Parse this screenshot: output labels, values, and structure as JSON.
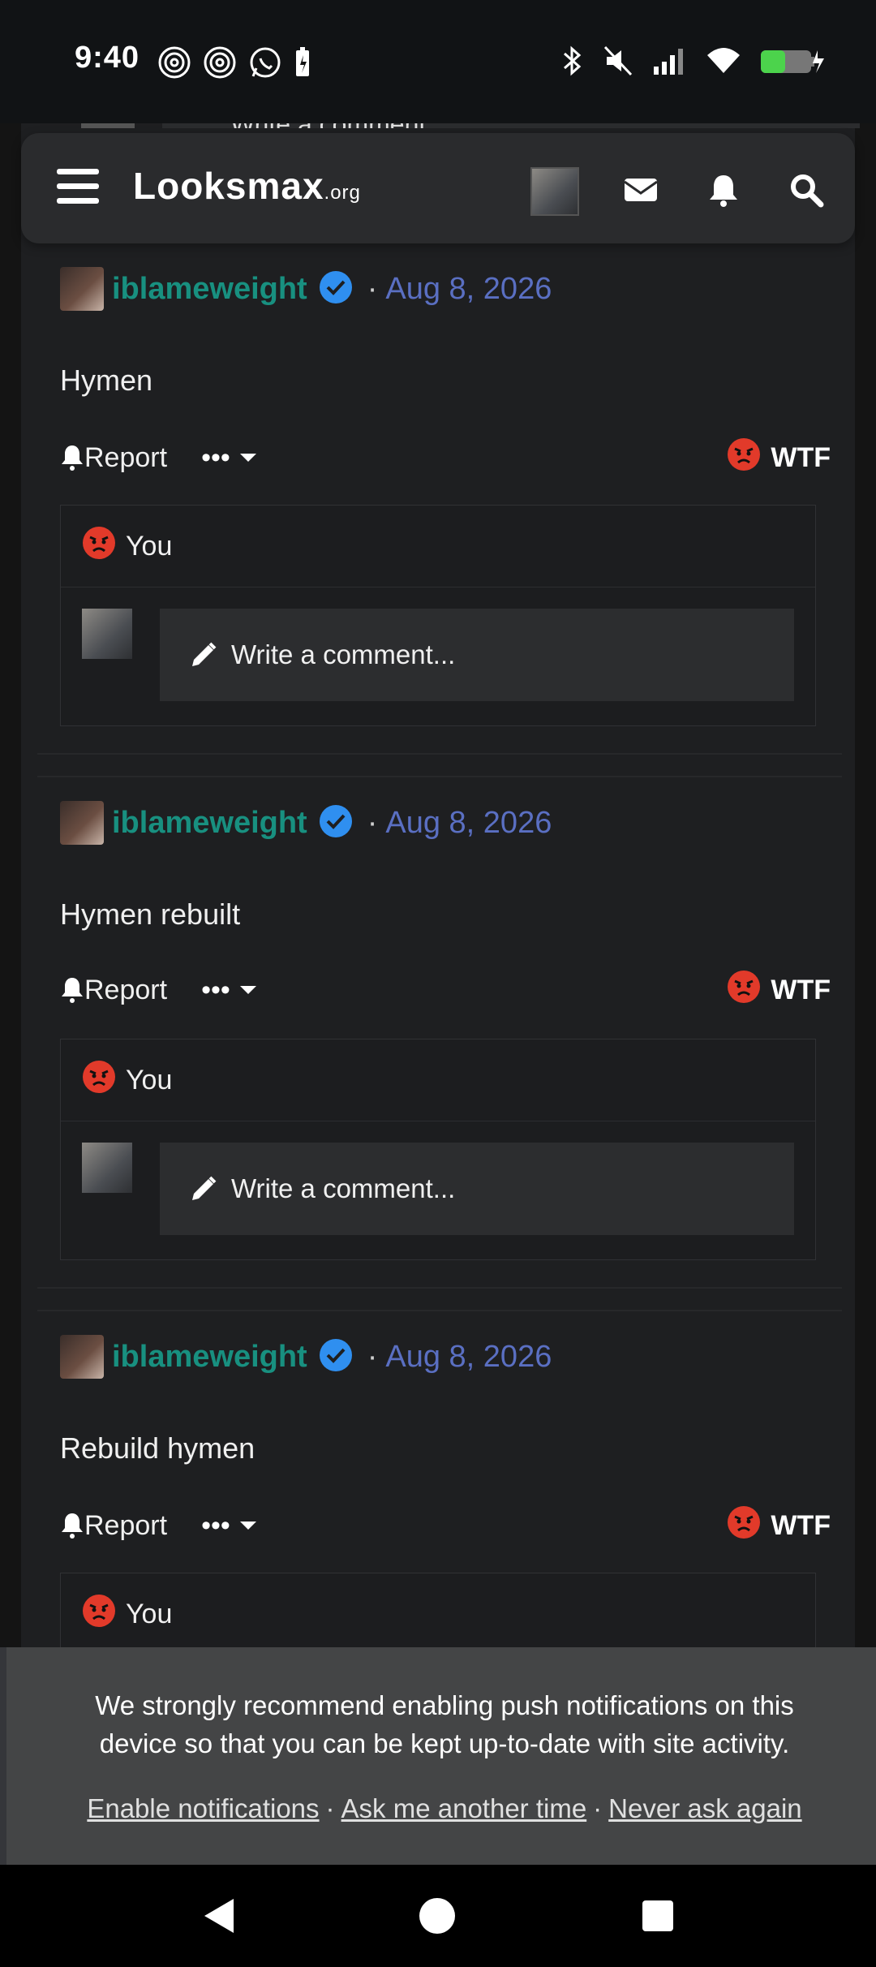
{
  "status_bar": {
    "time": "9:40"
  },
  "header": {
    "logo_main": "Looksmax",
    "logo_suffix": ".org"
  },
  "ghost": {
    "write_label": "Write a comment..."
  },
  "posts": [
    {
      "username": "iblameweight",
      "date": "Aug 8, 2026",
      "body": "Hymen",
      "report_label": "Report",
      "more_label": "•••",
      "reaction_label": "WTF",
      "reactor": "You",
      "write_label": "Write a comment..."
    },
    {
      "username": "iblameweight",
      "date": "Aug 8, 2026",
      "body": "Hymen rebuilt",
      "report_label": "Report",
      "more_label": "•••",
      "reaction_label": "WTF",
      "reactor": "You",
      "write_label": "Write a comment..."
    },
    {
      "username": "iblameweight",
      "date": "Aug 8, 2026",
      "body": "Rebuild hymen",
      "report_label": "Report",
      "more_label": "•••",
      "reaction_label": "WTF",
      "reactor": "You"
    }
  ],
  "notification": {
    "line1": "We strongly recommend enabling push notifications on this",
    "line2": "device so that you can be kept up-to-date with site activity.",
    "enable": "Enable notifications",
    "later": "Ask me another time",
    "never": "Never ask again",
    "separator": "·"
  },
  "colors": {
    "username": "#189080",
    "date": "#5a6fc2",
    "verified": "#2f8ff0",
    "angry": "#e23a2a"
  }
}
